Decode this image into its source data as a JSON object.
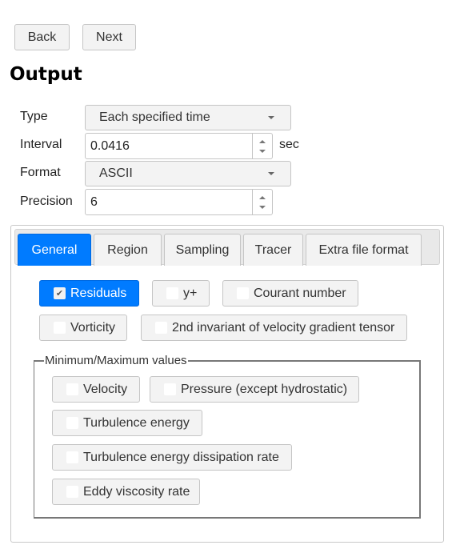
{
  "nav": {
    "back_label": "Back",
    "next_label": "Next"
  },
  "page_title": "Output",
  "form": {
    "type": {
      "label": "Type",
      "value": "Each specified time"
    },
    "interval": {
      "label": "Interval",
      "value": "0.0416",
      "unit": "sec"
    },
    "format": {
      "label": "Format",
      "value": "ASCII"
    },
    "precision": {
      "label": "Precision",
      "value": "6"
    }
  },
  "tabs": [
    {
      "label": "General",
      "active": true
    },
    {
      "label": "Region",
      "active": false
    },
    {
      "label": "Sampling",
      "active": false
    },
    {
      "label": "Tracer",
      "active": false
    },
    {
      "label": "Extra file format",
      "active": false
    }
  ],
  "general": {
    "options": [
      {
        "label": "Residuals",
        "checked": true
      },
      {
        "label": "y+",
        "checked": false
      },
      {
        "label": "Courant number",
        "checked": false
      },
      {
        "label": "Vorticity",
        "checked": false
      },
      {
        "label": "2nd invariant of velocity gradient tensor",
        "checked": false
      }
    ],
    "minmax": {
      "legend": "Minimum/Maximum values",
      "options": [
        {
          "label": "Velocity",
          "checked": false
        },
        {
          "label": "Pressure (except hydrostatic)",
          "checked": false
        },
        {
          "label": "Turbulence energy",
          "checked": false
        },
        {
          "label": "Turbulence energy dissipation rate",
          "checked": false
        },
        {
          "label": "Eddy viscosity rate",
          "checked": false
        }
      ]
    }
  },
  "colors": {
    "accent": "#007bff",
    "button_bg": "#f3f3f3",
    "border": "#c5c5c5"
  }
}
